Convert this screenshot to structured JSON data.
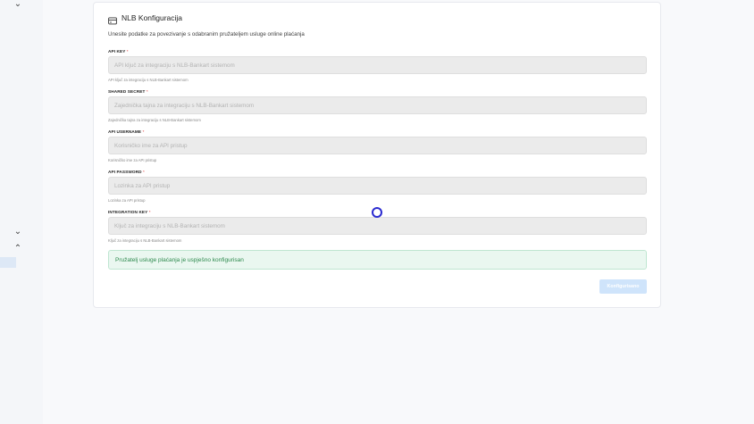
{
  "sidebar": {
    "chevrons": [
      "⌄",
      "⌄",
      "⌃"
    ]
  },
  "card": {
    "title": "NLB Konfiguracija",
    "icon": "credit-card-icon",
    "description": "Unesite podatke za povezivanje s odabranim pružateljem usluge online plaćanja"
  },
  "fields": [
    {
      "label": "API KEY",
      "required_mark": "*",
      "placeholder": "API ključ za integraciju s NLB-Bankart sistemom",
      "value": "",
      "help": "API ključ za integraciju s NLB-Bankart sistemom"
    },
    {
      "label": "SHARED SECRET",
      "required_mark": "*",
      "placeholder": "Zajednička tajna za integraciju s NLB-Bankart sistemom",
      "value": "",
      "help": "Zajednička tajna za integraciju s NLB-Bankart sistemom"
    },
    {
      "label": "API USERNAME",
      "required_mark": "*",
      "placeholder": "Korisničko ime za API pristup",
      "value": "",
      "help": "Korisničko ime za API pristup"
    },
    {
      "label": "API PASSWORD",
      "required_mark": "*",
      "placeholder": "Lozinka za API pristup",
      "value": "",
      "help": "Lozinka za API pristup"
    },
    {
      "label": "INTEGRATION KEY",
      "required_mark": "*",
      "placeholder": "Ključ za integraciju s NLB-Bankart sistemom",
      "value": "",
      "help": "Ključ za integraciju s NLB-Bankart sistemom"
    }
  ],
  "alert": {
    "text": "Pružatelj usluge plaćanja je uspješno konfigurisan",
    "color": "#2e8a4e"
  },
  "submit": {
    "label": "Konfigurisano",
    "color": "#cfe4fb"
  }
}
